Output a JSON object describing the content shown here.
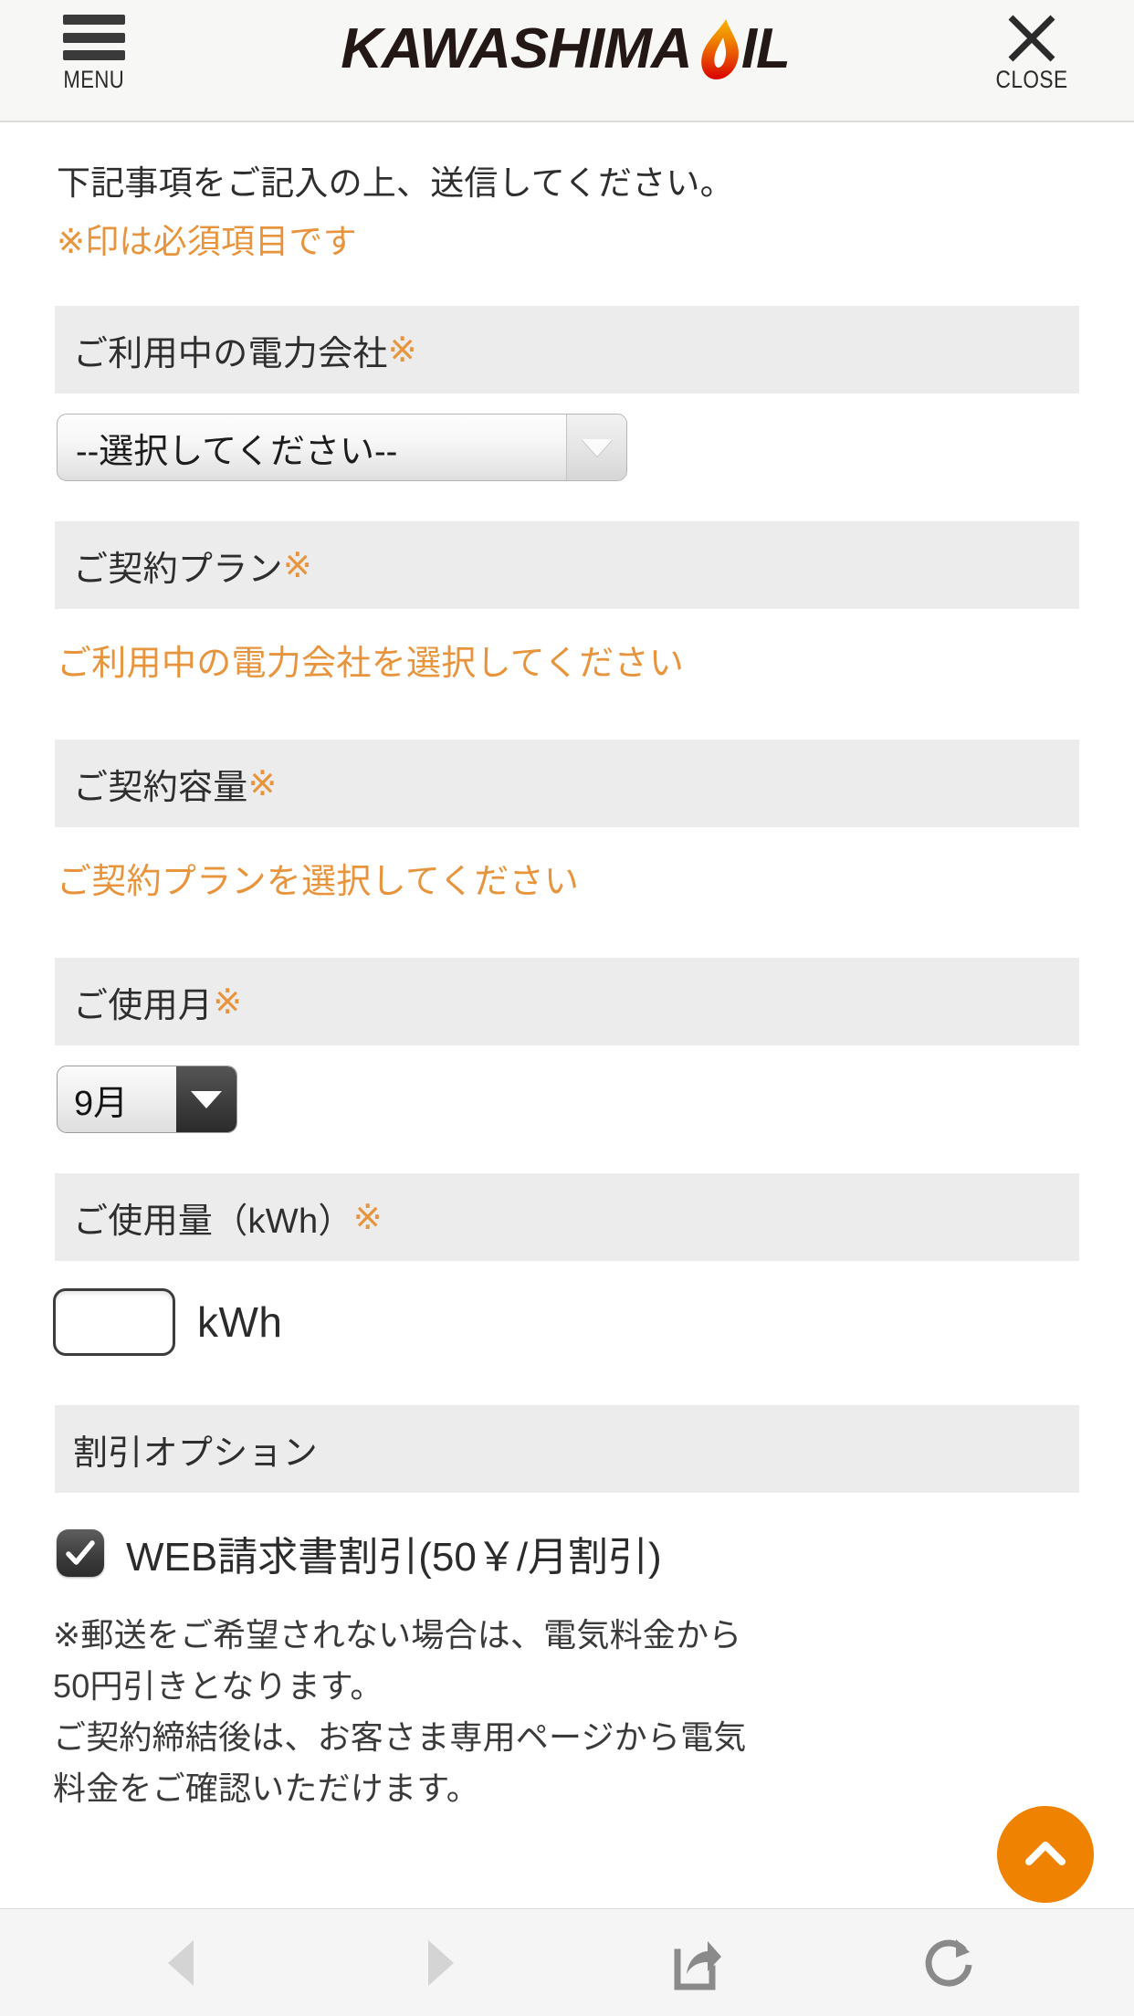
{
  "header": {
    "menu_label": "MENU",
    "menu_icon": "hamburger-icon",
    "logo_main": "KAWASHIMA",
    "logo_flame_icon": "flame-icon",
    "logo_suffix": "IL",
    "close_label": "CLOSE",
    "close_icon": "close-x-icon"
  },
  "colors": {
    "accent_orange": "#e8943c",
    "scroll_top_orange": "#ef8200",
    "field_header_bg": "#ececec",
    "logo_black": "#231815",
    "flame_top": "#f5a623",
    "flame_bottom": "#e01b00"
  },
  "intro": {
    "line1": "下記事項をご記入の上、送信してください。",
    "line2": "※印は必須項目です"
  },
  "form": {
    "electric_company": {
      "header_label": "ご利用中の電力会社",
      "required_mark": "※",
      "select_value": "--選択してください--",
      "arrow_icon": "chevron-down-icon"
    },
    "contract_plan": {
      "header_label": "ご契約プラン",
      "required_mark": "※",
      "error_message": "ご利用中の電力会社を選択してください"
    },
    "contract_capacity": {
      "header_label": "ご契約容量",
      "required_mark": "※",
      "error_message": "ご契約プランを選択してください"
    },
    "usage_month": {
      "header_label": "ご使用月",
      "required_mark": "※",
      "select_value": "9月",
      "arrow_icon": "chevron-down-icon"
    },
    "usage_amount": {
      "header_label": "ご使用量（kWh）",
      "required_mark": "※",
      "input_value": "",
      "input_placeholder": "",
      "unit_label": "kWh"
    },
    "discount_option": {
      "header_label": "割引オプション",
      "checkbox_checked": true,
      "checkbox_icon": "checkmark-icon",
      "checkbox_label": "WEB請求書割引(50￥/月割引)",
      "footnote": "※郵送をご希望されない場合は、電気料金から50円引きとなります。\nご契約締結後は、お客さま専用ページから電気料金をご確認いただけます。"
    }
  },
  "scroll_top": {
    "icon": "chevron-up-icon"
  },
  "toolbar": {
    "buttons": [
      {
        "name": "back-button",
        "icon": "triangle-left-icon",
        "enabled": false
      },
      {
        "name": "forward-button",
        "icon": "triangle-right-icon",
        "enabled": false
      },
      {
        "name": "share-button",
        "icon": "share-icon",
        "enabled": true
      },
      {
        "name": "reload-button",
        "icon": "reload-icon",
        "enabled": true
      }
    ]
  }
}
